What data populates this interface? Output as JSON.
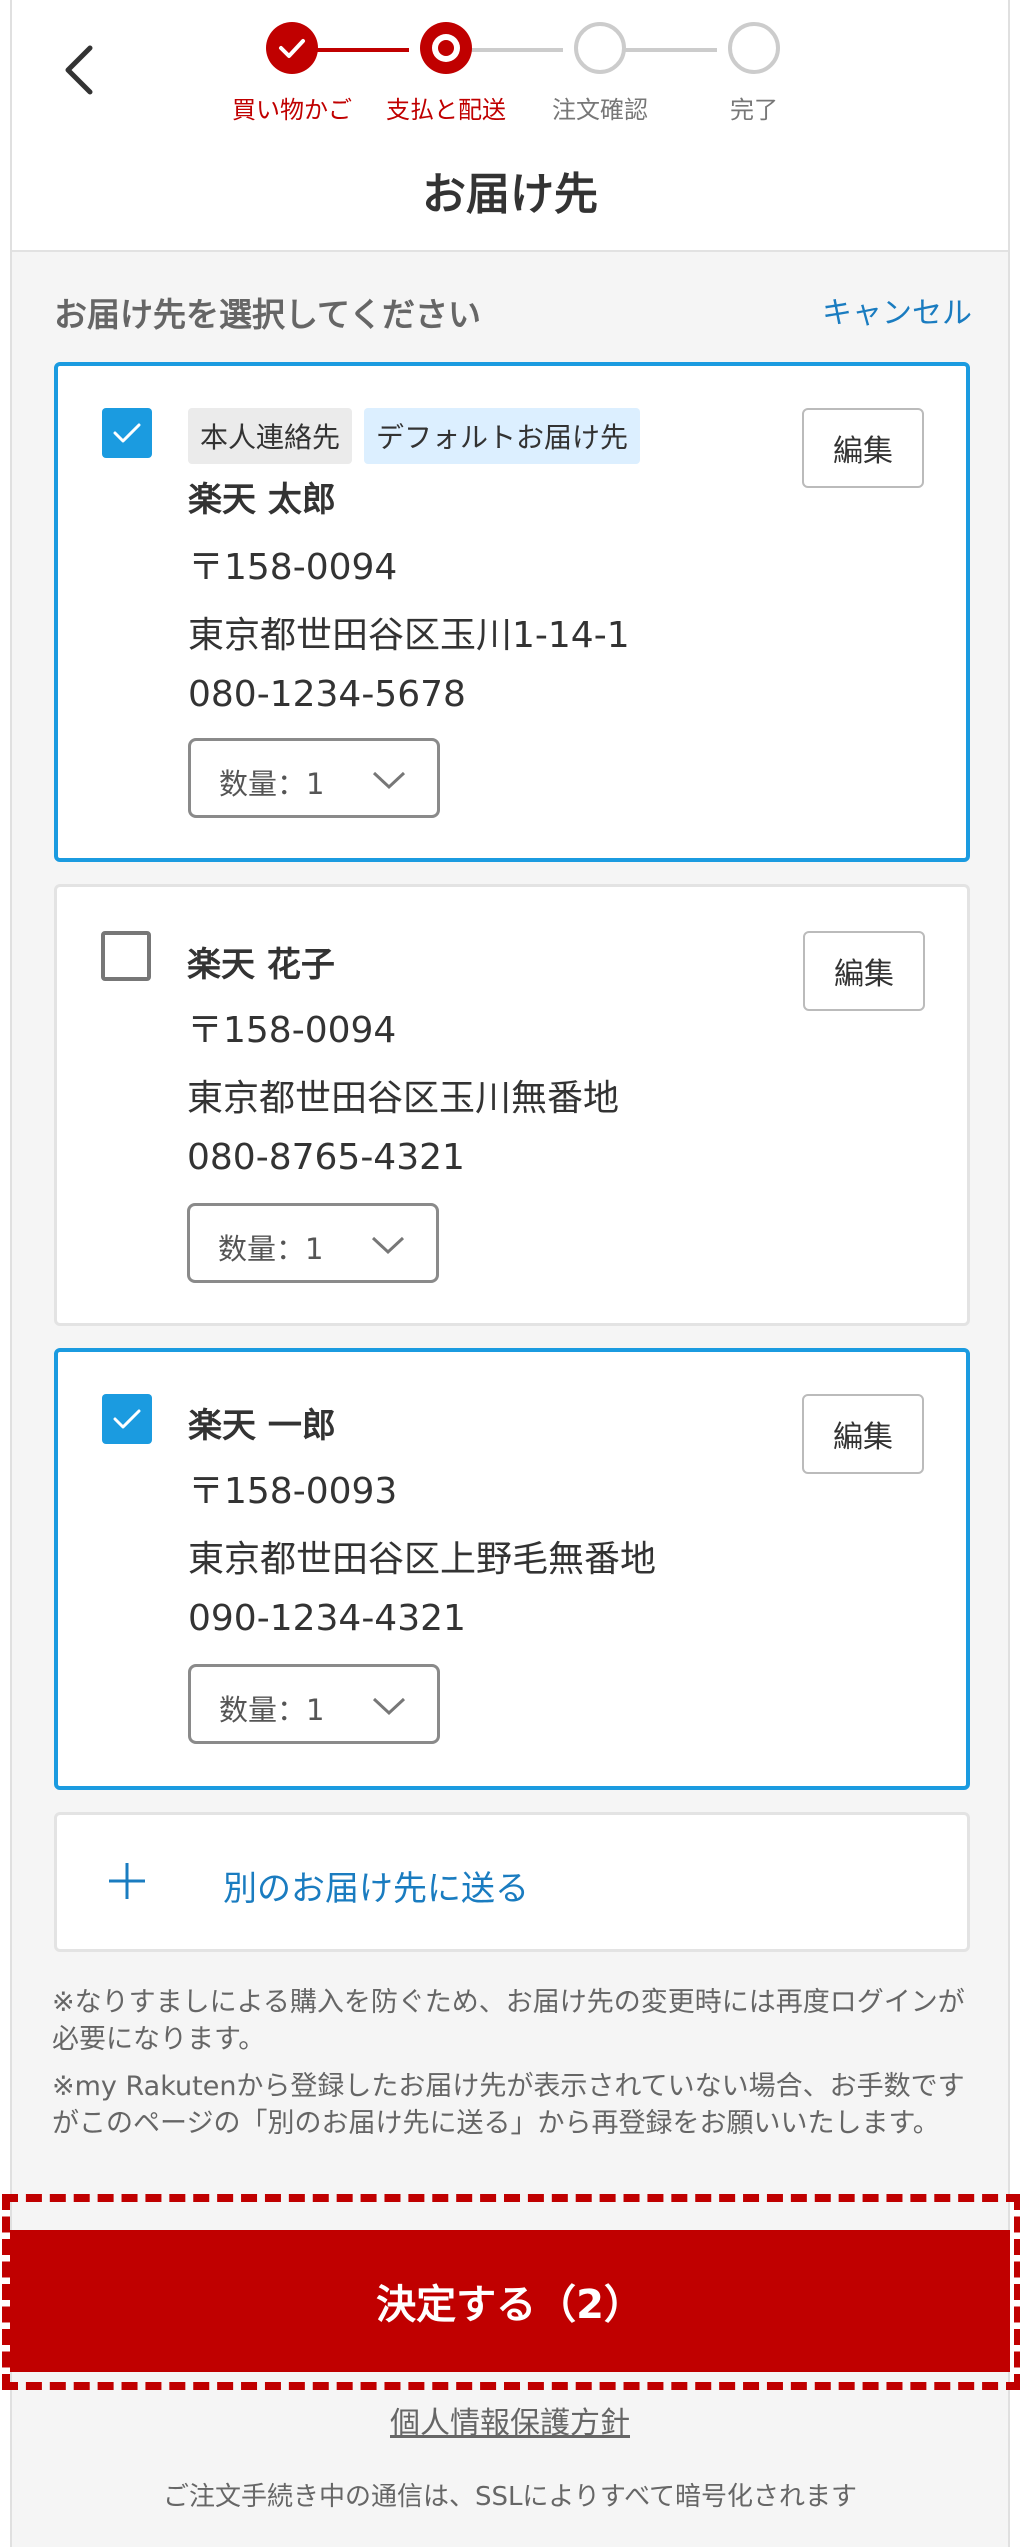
{
  "header": {
    "title": "お届け先",
    "steps": [
      {
        "label": "買い物かご",
        "state": "done"
      },
      {
        "label": "支払と配送",
        "state": "current"
      },
      {
        "label": "注文確認",
        "state": "todo"
      },
      {
        "label": "完了",
        "state": "todo"
      }
    ]
  },
  "section": {
    "heading": "お届け先を選択してください",
    "cancel_label": "キャンセル"
  },
  "addresses": [
    {
      "selected": true,
      "tags": [
        "本人連絡先",
        "デフォルトお届け先"
      ],
      "name": "楽天 太郎",
      "postal": "〒158-0094",
      "address": "東京都世田谷区玉川1-14-1",
      "phone": "080-1234-5678",
      "quantity_label": "数量：1",
      "edit_label": "編集"
    },
    {
      "selected": false,
      "tags": [],
      "name": "楽天 花子",
      "postal": "〒158-0094",
      "address": "東京都世田谷区玉川無番地",
      "phone": "080-8765-4321",
      "quantity_label": "数量：1",
      "edit_label": "編集"
    },
    {
      "selected": true,
      "tags": [],
      "name": "楽天 一郎",
      "postal": "〒158-0093",
      "address": "東京都世田谷区上野毛無番地",
      "phone": "090-1234-4321",
      "quantity_label": "数量：1",
      "edit_label": "編集"
    }
  ],
  "add_address_label": "別のお届け先に送る",
  "notes": [
    "※なりすましによる購入を防ぐため、お届け先の変更時には再度ログインが必要になります。",
    "※my Rakutenから登録したお届け先が表示されていない場合、お手数ですがこのページの「別のお届け先に送る」から再登録をお願いいたします。"
  ],
  "confirm_label": "決定する（2）",
  "policy_link": "個人情報保護方針",
  "ssl_notice": "ご注文手続き中の通信は、SSLによりすべて暗号化されます",
  "colors": {
    "brand_red": "#c00000",
    "select_blue": "#1b9be0",
    "link_blue": "#1a7cc0"
  }
}
